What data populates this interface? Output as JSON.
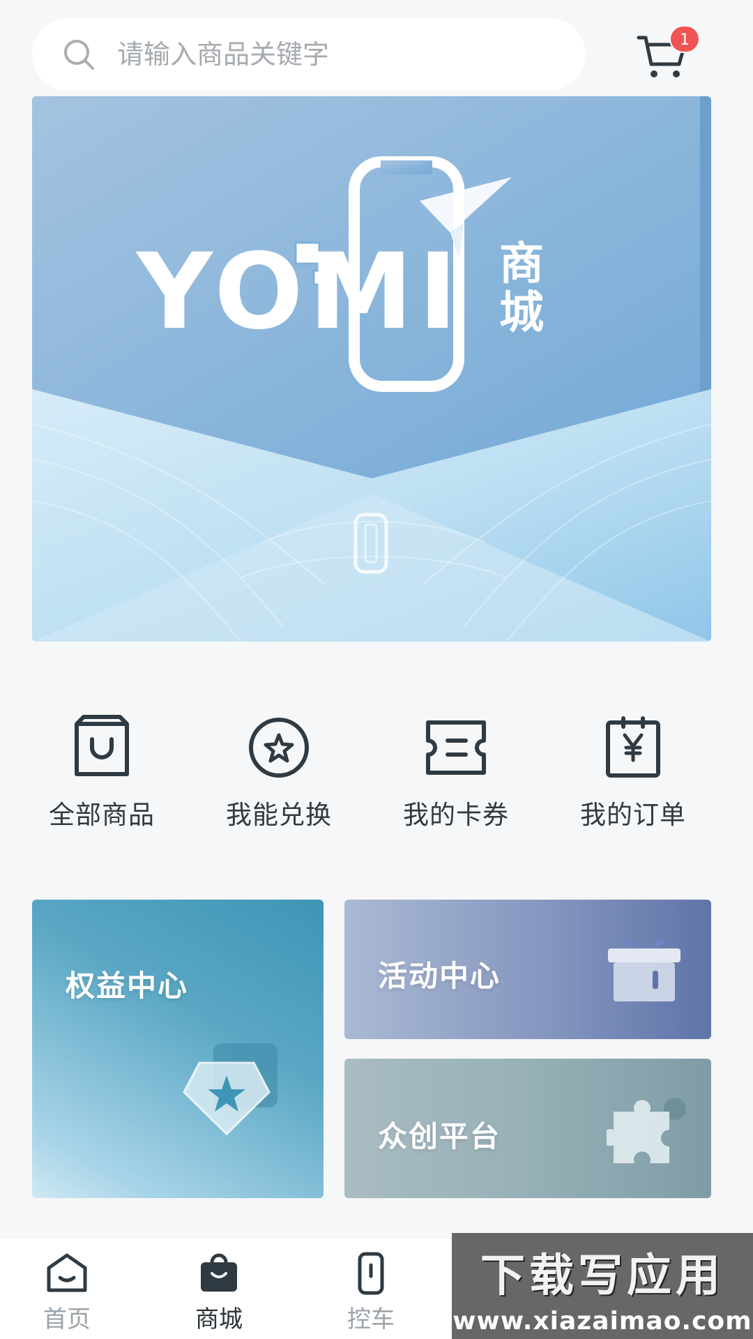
{
  "search": {
    "placeholder": "请输入商品关键字"
  },
  "cart": {
    "badge_count": "1"
  },
  "banner": {
    "logo_text": "YOMI",
    "logo_suffix_top": "商",
    "logo_suffix_bottom": "城"
  },
  "quick_entries": [
    {
      "label": "全部商品",
      "icon": "shopping-bag-icon"
    },
    {
      "label": "我能兑换",
      "icon": "star-circle-icon"
    },
    {
      "label": "我的卡券",
      "icon": "ticket-icon"
    },
    {
      "label": "我的订单",
      "icon": "order-yen-icon"
    }
  ],
  "cards": {
    "rights": {
      "title": "权益中心",
      "icon": "star-shield-icon"
    },
    "activity": {
      "title": "活动中心",
      "icon": "gift-box-icon"
    },
    "platform": {
      "title": "众创平台",
      "icon": "puzzle-icon"
    }
  },
  "tabbar": {
    "items": [
      {
        "label": "首页",
        "icon": "home-icon",
        "active": false
      },
      {
        "label": "商城",
        "icon": "shop-bag-icon",
        "active": true
      },
      {
        "label": "控车",
        "icon": "car-key-icon",
        "active": false
      }
    ]
  },
  "watermark": {
    "title": "下载写应用",
    "url": "www.xiazaimao.com"
  },
  "colors": {
    "page_bg": "#f6f7f8",
    "badge": "#f05454",
    "text_dark": "#2b3338",
    "tab_inactive": "#9aa2a8"
  }
}
